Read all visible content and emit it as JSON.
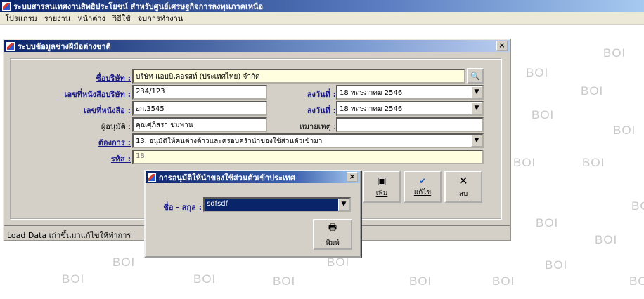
{
  "app": {
    "title": "ระบบสารสนเทศงานสิทธิประโยชน์ สำหรับศูนย์เศรษฐกิจการลงทุนภาคเหนือ"
  },
  "menu": [
    "โปรแกรม",
    "รายงาน",
    "หน้าต่าง",
    "วิธีใช้",
    "จบการทำงาน"
  ],
  "watermark_text": "BOI",
  "child_window": {
    "title": "ระบบข้อมูลช่างฝีมือต่างชาติ",
    "close_label": "×",
    "form": {
      "company_label": "ชื่อบริษัท :",
      "company_value": "บริษัท แอบบิเคอรสท์ (ประเทศไทย) จำกัด",
      "company_search": "🔍",
      "cert_no_label": "เลขที่หนังสือบริษัท :",
      "cert_no_value": "234/123",
      "cert_date_label": "ลงวันที่ :",
      "cert_date_value": "18 พฤษภาคม  2546",
      "doc_no_label": "เลขที่หนังสือ :",
      "doc_no_value": "อก.3545",
      "doc_date_label": "ลงวันที่ :",
      "doc_date_value": "18 พฤษภาคม  2546",
      "approver_label": "ผู้อนุมัติ :",
      "approver_value": "คุณศุภิสรา ชมพาน",
      "note_label": "หมายเหตุ :",
      "note_value": "",
      "request_label": "ต้องการ :",
      "request_value": "13. อนุมัติให้คนต่างด้าวและครอบครัวนำของใช้ส่วนตัวเข้ามา",
      "code_label": "รหัส :",
      "code_value": "18"
    },
    "buttons": {
      "add_label": "เพิ่ม",
      "edit_label": "แก้ไข",
      "delete_label": "ลบ"
    },
    "status_text": "Load Data เก่าขึ้นมาแก้ไขให้ทำการ"
  },
  "dialog": {
    "title": "การอนุมัติให้นำของใช้ส่วนตัวเข้าประเทศ",
    "close_label": "×",
    "name_label": "ชื่อ - สกุล :",
    "name_value": "sdfsdf",
    "print_label": "พิมพ์"
  }
}
